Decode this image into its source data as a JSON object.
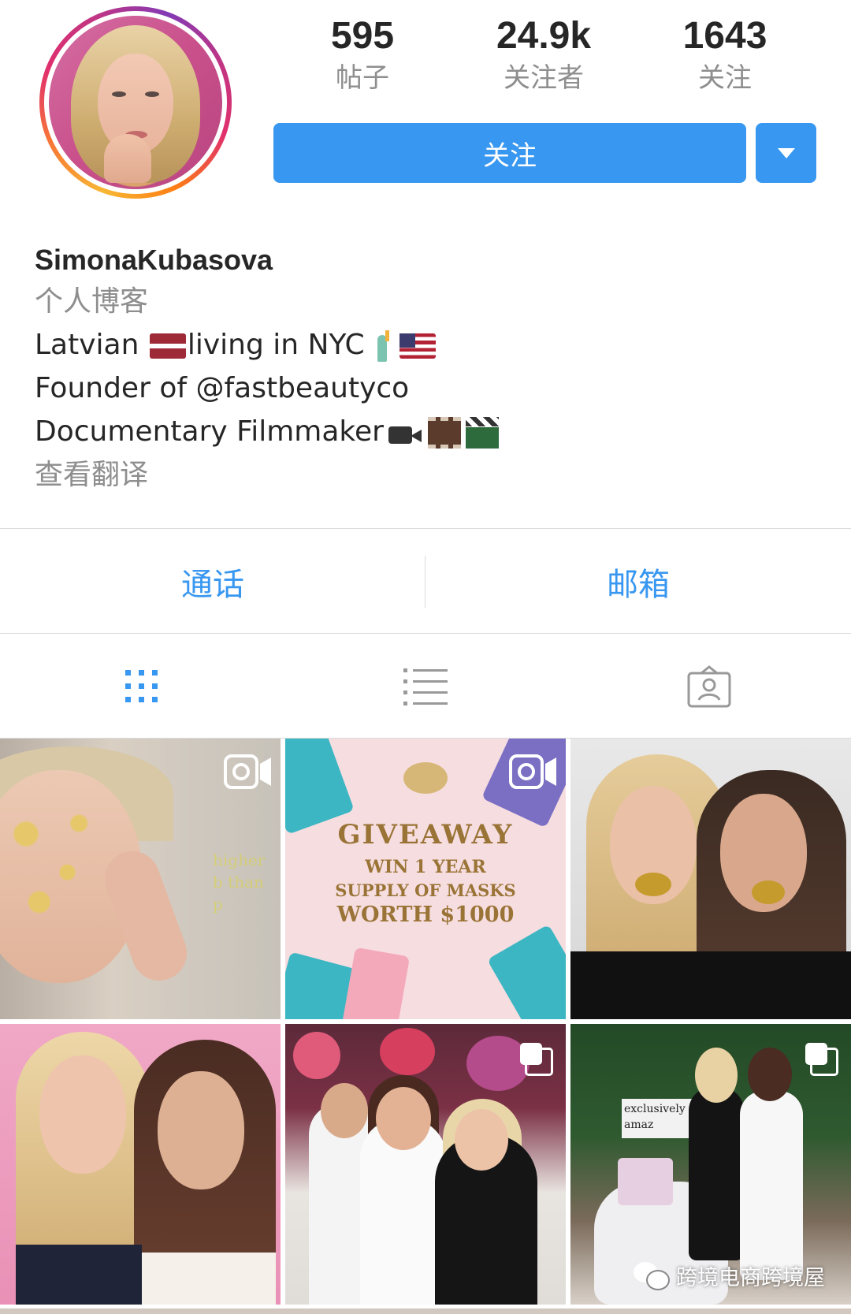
{
  "profile": {
    "username": "SimonaKubasova",
    "category": "个人博客",
    "bio_lines": [
      "Latvian ",
      "living in NYC",
      "Founder of @fastbeautyco",
      "Documentary Filmmaker"
    ],
    "translate_label": "查看翻译"
  },
  "stats": {
    "posts": {
      "value": "595",
      "label": "帖子"
    },
    "followers": {
      "value": "24.9k",
      "label": "关注者"
    },
    "following": {
      "value": "1643",
      "label": "关注"
    }
  },
  "actions": {
    "follow_label": "关注"
  },
  "contact": {
    "call_label": "通话",
    "email_label": "邮箱"
  },
  "tabs": [
    {
      "name": "grid-icon",
      "active": true
    },
    {
      "name": "list-icon",
      "active": false
    },
    {
      "name": "tagged-icon",
      "active": false
    }
  ],
  "posts": {
    "giveaway": {
      "title": "GIVEAWAY",
      "line1": "WIN 1 YEAR",
      "line2": "SUPPLY OF MASKS",
      "line3": "WORTH $1000"
    },
    "video_text": "higher b than p",
    "sign_text": "exclusively amaz"
  },
  "watermark": {
    "text": "跨境电商跨境屋"
  },
  "colors": {
    "accent": "#3897f0",
    "text_primary": "#262626",
    "text_secondary": "#8e8e8e",
    "divider": "#dbdbdb"
  }
}
